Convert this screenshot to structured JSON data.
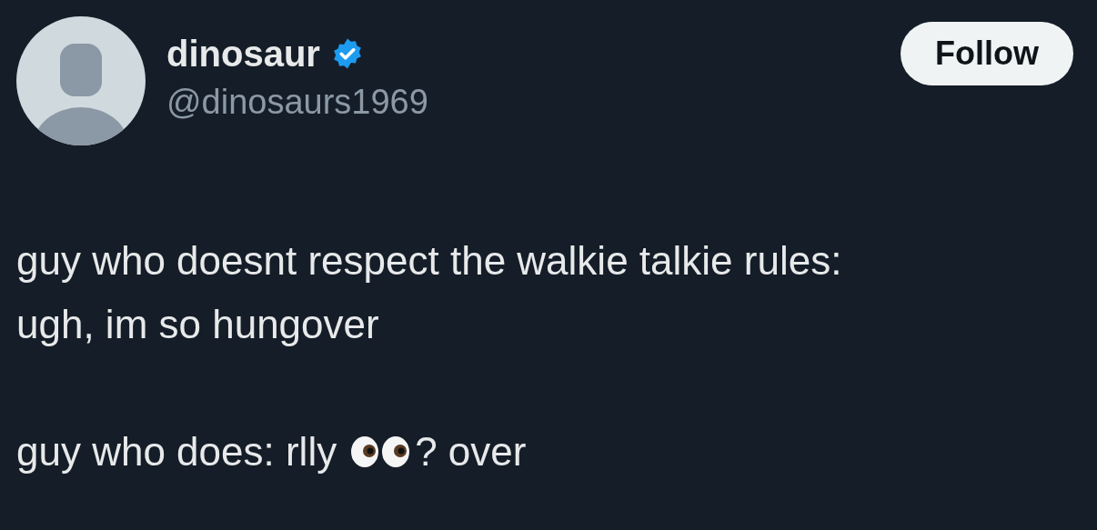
{
  "author": {
    "name": "dinosaur",
    "verified": true,
    "handle": "@dinosaurs1969"
  },
  "follow_button": "Follow",
  "paragraphs": [
    {
      "kind": "text",
      "lines": [
        "guy who doesnt respect the walkie talkie rules:",
        "ugh, im so hungover"
      ]
    },
    {
      "kind": "emoji-line",
      "before": "guy who does: rlly",
      "after": "? over"
    }
  ]
}
